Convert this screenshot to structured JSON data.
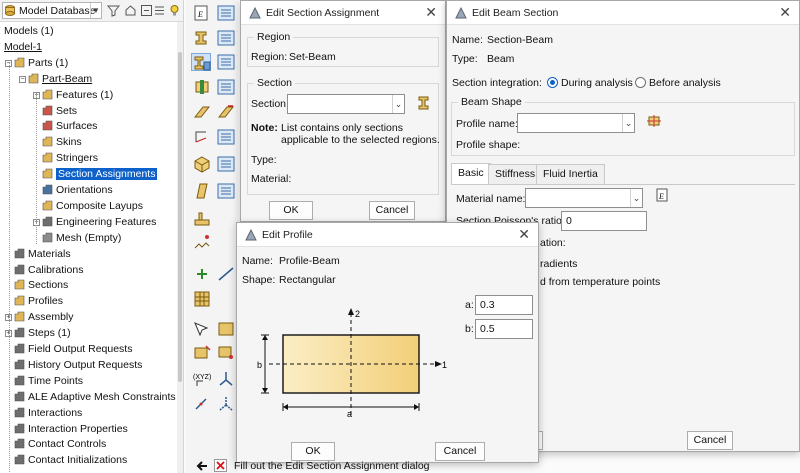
{
  "topbar": {
    "database_label": "Model Database"
  },
  "tree": {
    "rows": [
      {
        "label": "Models (1)",
        "indent": 0,
        "icon": "none",
        "underline": false
      },
      {
        "label": "Model-1",
        "indent": 0,
        "icon": "none",
        "underline": true
      },
      {
        "label": "Parts (1)",
        "indent": 1,
        "icon": "parts-icon",
        "underline": false
      },
      {
        "label": "Part-Beam",
        "indent": 2,
        "icon": "part-icon",
        "underline": true
      },
      {
        "label": "Features (1)",
        "indent": 3,
        "icon": "features-icon",
        "underline": false
      },
      {
        "label": "Sets",
        "indent": 3,
        "icon": "sets-icon",
        "underline": false
      },
      {
        "label": "Surfaces",
        "indent": 3,
        "icon": "surfaces-icon",
        "underline": false
      },
      {
        "label": "Skins",
        "indent": 3,
        "icon": "skins-icon",
        "underline": false
      },
      {
        "label": "Stringers",
        "indent": 3,
        "icon": "stringers-icon",
        "underline": false
      },
      {
        "label": "Section Assignments",
        "indent": 3,
        "icon": "section-assignment-icon",
        "underline": false,
        "selected": true
      },
      {
        "label": "Orientations",
        "indent": 3,
        "icon": "orientations-icon",
        "underline": false
      },
      {
        "label": "Composite Layups",
        "indent": 3,
        "icon": "composite-icon",
        "underline": false
      },
      {
        "label": "Engineering Features",
        "indent": 3,
        "icon": "engineering-icon",
        "underline": false
      },
      {
        "label": "Mesh (Empty)",
        "indent": 3,
        "icon": "mesh-icon",
        "underline": false
      },
      {
        "label": "Materials",
        "indent": 1,
        "icon": "materials-icon",
        "underline": false
      },
      {
        "label": "Calibrations",
        "indent": 1,
        "icon": "calibrations-icon",
        "underline": false
      },
      {
        "label": "Sections",
        "indent": 1,
        "icon": "sections-icon",
        "underline": false
      },
      {
        "label": "Profiles",
        "indent": 1,
        "icon": "profiles-icon",
        "underline": false
      },
      {
        "label": "Assembly",
        "indent": 1,
        "icon": "assembly-icon",
        "underline": false
      },
      {
        "label": "Steps (1)",
        "indent": 1,
        "icon": "steps-icon",
        "underline": false
      },
      {
        "label": "Field Output Requests",
        "indent": 1,
        "icon": "field-output-icon",
        "underline": false
      },
      {
        "label": "History Output Requests",
        "indent": 1,
        "icon": "history-output-icon",
        "underline": false
      },
      {
        "label": "Time Points",
        "indent": 1,
        "icon": "time-points-icon",
        "underline": false
      },
      {
        "label": "ALE Adaptive Mesh Constraints",
        "indent": 1,
        "icon": "ale-icon",
        "underline": false
      },
      {
        "label": "Interactions",
        "indent": 1,
        "icon": "interactions-icon",
        "underline": false
      },
      {
        "label": "Interaction Properties",
        "indent": 1,
        "icon": "interaction-props-icon",
        "underline": false
      },
      {
        "label": "Contact Controls",
        "indent": 1,
        "icon": "contact-controls-icon",
        "underline": false
      },
      {
        "label": "Contact Initializations",
        "indent": 1,
        "icon": "contact-init-icon",
        "underline": false
      }
    ]
  },
  "section_assignment": {
    "title": "Edit Section Assignment",
    "region_group": "Region",
    "region_label": "Region:",
    "region_value": "Set-Beam",
    "section_group": "Section",
    "section_label": "Section:",
    "section_value": "",
    "note_label": "Note:",
    "note_line1": "List contains only sections",
    "note_line2": "applicable to the selected regions.",
    "type_label": "Type:",
    "material_label": "Material:",
    "ok": "OK",
    "cancel": "Cancel"
  },
  "beam_section": {
    "title": "Edit Beam Section",
    "name_label": "Name:",
    "name_value": "Section-Beam",
    "type_label": "Type:",
    "type_value": "Beam",
    "integration_label": "Section integration:",
    "integration_options": [
      "During analysis",
      "Before analysis"
    ],
    "integration_selected": "During analysis",
    "beam_shape_group": "Beam Shape",
    "profile_name_label": "Profile name:",
    "profile_name_value": "",
    "profile_shape_label": "Profile shape:",
    "tabs": [
      "Basic",
      "Stiffness",
      "Fluid Inertia"
    ],
    "active_tab": "Basic",
    "material_name_label": "Material name:",
    "material_name_value": "",
    "poisson_label": "Section Poisson's ratio:",
    "poisson_value": "0",
    "partial_line1": "ation:",
    "partial_line2": "radients",
    "partial_line3": "d from temperature points",
    "ok_partial": "K",
    "cancel": "Cancel"
  },
  "edit_profile": {
    "title": "Edit Profile",
    "name_label": "Name:",
    "name_value": "Profile-Beam",
    "shape_label": "Shape:",
    "shape_value": "Rectangular",
    "a_label": "a:",
    "a_value": "0.3",
    "b_label": "b:",
    "b_value": "0.5",
    "axis_2": "2",
    "axis_1": "1",
    "dim_a": "a",
    "dim_b": "b",
    "ok": "OK",
    "cancel": "Cancel"
  },
  "status": {
    "prompt": "Fill out the Edit Section Assignment dialog"
  },
  "colors": {
    "selection": "#0d61c9",
    "profile_fill_light": "#fbeec5",
    "profile_fill_dark": "#f2cf78"
  }
}
